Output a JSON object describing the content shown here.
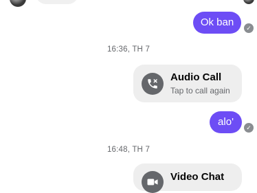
{
  "messages": {
    "ok_ban": "Ok ban",
    "alo": "alo'"
  },
  "timestamps": {
    "first": "16:36, TH 7",
    "second": "16:48, TH 7"
  },
  "audio_call": {
    "title": "Audio Call",
    "subtitle": "Tap to call again",
    "icon": "missed-call-icon"
  },
  "video_chat": {
    "title": "Video Chat",
    "icon": "video-call-icon"
  },
  "status": {
    "seen_icon": "check-icon"
  },
  "colors": {
    "outgoing_bubble": "#6d4df5",
    "card_background": "#eeeeee",
    "secondary_text": "#65676b"
  }
}
